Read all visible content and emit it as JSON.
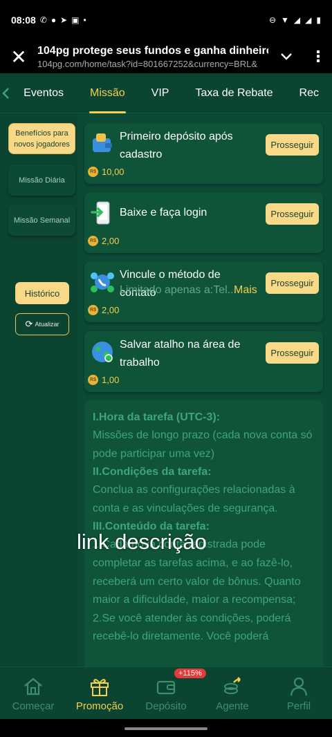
{
  "status": {
    "time": "08:08"
  },
  "browser": {
    "title": "104pg protege seus fundos e ganha dinheiro",
    "url": "104pg.com/home/task?id=801667252&currency=BRL&"
  },
  "tabs": [
    "Eventos",
    "Missão",
    "VIP",
    "Taxa de Rebate",
    "Rec"
  ],
  "sidebar": {
    "beneficios": "Benefícios para novos jogadores",
    "diaria": "Missão Diária",
    "semanal": "Missão Semanal",
    "historico": "Histórico",
    "atualizar": "Atualizar"
  },
  "currency_symbol": "R$",
  "tasks": [
    {
      "title": "Primeiro depósito após cadastro",
      "button": "Prosseguir",
      "reward": "10,00",
      "icon": "wallet-icon"
    },
    {
      "title": "Baixe e faça login",
      "button": "Prosseguir",
      "reward": "2,00",
      "icon": "phone-login-icon"
    },
    {
      "title": "Vincule o método de contato",
      "subtitle": "Limitado apenas a:Tel...",
      "more": "Mais",
      "button": "Prosseguir",
      "reward": "2,00",
      "icon": "contacts-icon"
    },
    {
      "title": "Salvar atalho na área de trabalho",
      "button": "Prosseguir",
      "reward": "1,00",
      "icon": "globe-icon"
    }
  ],
  "description": {
    "h1": "I.Hora da tarefa (UTC-3):",
    "p1": "Missões de longo prazo (cada nova conta só pode participar uma vez)",
    "h2": "II.Condições da tarefa:",
    "p2": "Conclua as configurações relacionadas à conta e as vinculações de segurança.",
    "h3": "III.Conteúdo da tarefa:",
    "p3": "1.Cada nova conta registrada pode completar as tarefas acima, e ao fazê-lo, receberá um certo valor de bônus. Quanto maior a dificuldade, maior a recompensa;",
    "p4": "2.Se você atender às condições, poderá recebê-lo diretamente. Você poderá"
  },
  "overlay": "link descrição",
  "bottom_nav": [
    {
      "label": "Começar",
      "icon": "home-icon"
    },
    {
      "label": "Promoção",
      "icon": "gift-icon"
    },
    {
      "label": "Depósito",
      "icon": "wallet-icon",
      "badge": "+115%"
    },
    {
      "label": "Agente",
      "icon": "coins-icon"
    },
    {
      "label": "Perfil",
      "icon": "person-icon"
    }
  ],
  "colors": {
    "accent": "#f5cf4f",
    "background": "#0c4a36",
    "button": "#f7d987"
  }
}
